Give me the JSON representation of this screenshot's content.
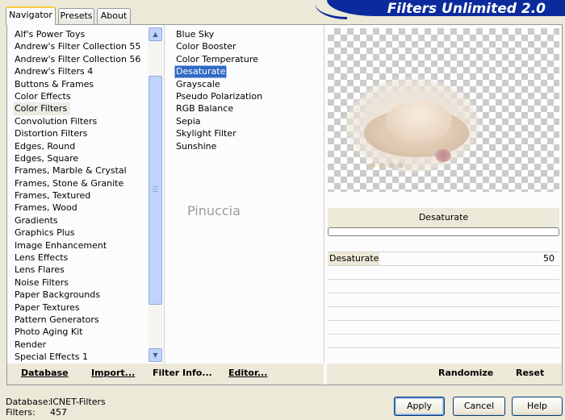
{
  "tabs": [
    {
      "label": "Navigator",
      "active": true
    },
    {
      "label": "Presets",
      "active": false
    },
    {
      "label": "About",
      "active": false
    }
  ],
  "banner": {
    "title": "Filters Unlimited 2.0"
  },
  "categories": {
    "items": [
      "Alf's Power Toys",
      "Andrew's Filter Collection 55",
      "Andrew's Filter Collection 56",
      "Andrew's Filters 4",
      "Buttons & Frames",
      "Color Effects",
      "Color Filters",
      "Convolution Filters",
      "Distortion Filters",
      "Edges, Round",
      "Edges, Square",
      "Frames, Marble & Crystal",
      "Frames, Stone & Granite",
      "Frames, Textured",
      "Frames, Wood",
      "Gradients",
      "Graphics Plus",
      "Image Enhancement",
      "Lens Effects",
      "Lens Flares",
      "Noise Filters",
      "Paper Backgrounds",
      "Paper Textures",
      "Pattern Generators",
      "Photo Aging Kit",
      "Render",
      "Special Effects 1"
    ],
    "selected": "Color Filters"
  },
  "filters": {
    "items": [
      "Blue Sky",
      "Color Booster",
      "Color Temperature",
      "Desaturate",
      "Grayscale",
      "Pseudo Polarization",
      "RGB Balance",
      "Sepia",
      "Skylight Filter",
      "Sunshine"
    ],
    "selected": "Desaturate"
  },
  "watermark": "Pinuccia",
  "preview": {
    "filter_name": "Desaturate",
    "progress": 0,
    "params": [
      {
        "name": "Desaturate",
        "value": "50"
      }
    ]
  },
  "commands": {
    "database": "Database",
    "import": "Import...",
    "filter_info": "Filter Info...",
    "editor": "Editor...",
    "randomize": "Randomize",
    "reset": "Reset"
  },
  "footer": {
    "database_label": "Database:",
    "database_value": "ICNET-Filters",
    "filters_label": "Filters:",
    "filters_value": "457",
    "apply": "Apply",
    "cancel": "Cancel",
    "help": "Help"
  },
  "colors": {
    "selection": "#316ac5",
    "banner": "#0b2a9c",
    "dialog_bg": "#ece9d8"
  }
}
